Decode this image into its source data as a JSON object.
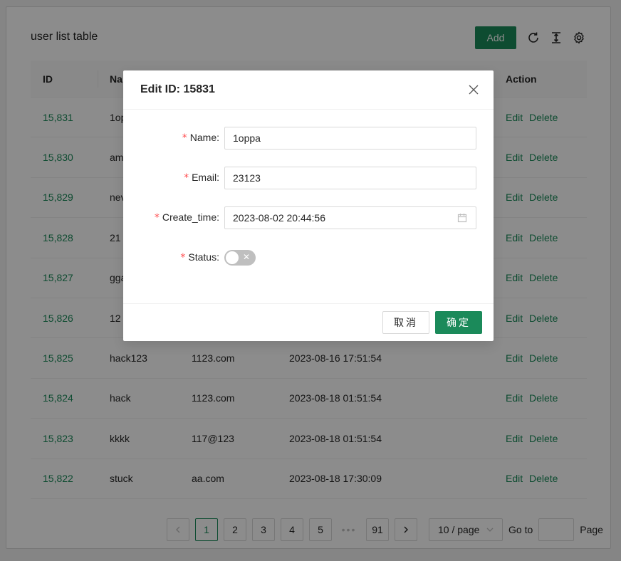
{
  "page": {
    "title": "user list table",
    "add_label": "Add",
    "icons": [
      "reload-icon",
      "column-height-icon",
      "setting-icon"
    ]
  },
  "colors": {
    "primary": "#1b8a5a",
    "danger": "#ff4d4f"
  },
  "table": {
    "columns": [
      "ID",
      "Na",
      "Action"
    ],
    "rows": [
      {
        "id": "15,831",
        "name": "1op",
        "email": "",
        "time": "",
        "status": null,
        "edit": "Edit",
        "delete": "Delete"
      },
      {
        "id": "15,830",
        "name": "am",
        "email": "",
        "time": "",
        "status": null,
        "edit": "Edit",
        "delete": "Delete"
      },
      {
        "id": "15,829",
        "name": "nev",
        "email": "",
        "time": "",
        "status": null,
        "edit": "Edit",
        "delete": "Delete"
      },
      {
        "id": "15,828",
        "name": "21",
        "email": "",
        "time": "",
        "status": null,
        "edit": "Edit",
        "delete": "Delete"
      },
      {
        "id": "15,827",
        "name": "gga",
        "email": "",
        "time": "",
        "status": null,
        "edit": "Edit",
        "delete": "Delete"
      },
      {
        "id": "15,826",
        "name": "12",
        "email": "",
        "time": "",
        "status": null,
        "edit": "Edit",
        "delete": "Delete"
      },
      {
        "id": "15,825",
        "name": "hack123",
        "email": "1123.com",
        "time": "2023-08-16 17:51:54",
        "status": true,
        "edit": "Edit",
        "delete": "Delete"
      },
      {
        "id": "15,824",
        "name": "hack",
        "email": "1123.com",
        "time": "2023-08-18 01:51:54",
        "status": true,
        "edit": "Edit",
        "delete": "Delete"
      },
      {
        "id": "15,823",
        "name": "kkkk",
        "email": "117@123",
        "time": "2023-08-18 01:51:54",
        "status": true,
        "edit": "Edit",
        "delete": "Delete"
      },
      {
        "id": "15,822",
        "name": "stuck",
        "email": "aa.com",
        "time": "2023-08-18 17:30:09",
        "status": true,
        "edit": "Edit",
        "delete": "Delete"
      }
    ],
    "switch_on_mark": "✓"
  },
  "pagination": {
    "pages": [
      "1",
      "2",
      "3",
      "4",
      "5"
    ],
    "ellipsis": "•••",
    "last_page": "91",
    "current": "1",
    "page_size": "10 / page",
    "goto_label": "Go to",
    "page_label": "Page"
  },
  "modal": {
    "title": "Edit ID: 15831",
    "required_mark": "*",
    "fields": {
      "name": {
        "label": "Name:",
        "value": "1oppa"
      },
      "email": {
        "label": "Email:",
        "value": "23123"
      },
      "create_time": {
        "label": "Create_time:",
        "value": "2023-08-02 20:44:56"
      },
      "status": {
        "label": "Status:",
        "value": false,
        "off_mark": "✕"
      }
    },
    "cancel_label": "取消",
    "ok_label": "确定"
  }
}
